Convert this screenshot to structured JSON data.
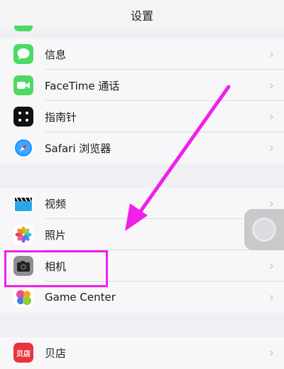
{
  "header": {
    "title": "设置"
  },
  "groups": [
    {
      "items": [
        {
          "label": "信息",
          "icon": "messages-icon"
        },
        {
          "label": "FaceTime 通话",
          "icon": "facetime-icon"
        },
        {
          "label": "指南针",
          "icon": "compass-icon"
        },
        {
          "label": "Safari 浏览器",
          "icon": "safari-icon"
        }
      ]
    },
    {
      "items": [
        {
          "label": "视频",
          "icon": "videos-icon"
        },
        {
          "label": "照片",
          "icon": "photos-icon"
        },
        {
          "label": "相机",
          "icon": "camera-icon"
        },
        {
          "label": "Game Center",
          "icon": "game-center-icon"
        }
      ]
    },
    {
      "items": [
        {
          "label": "贝店",
          "icon": "beidian-app-icon",
          "icon_text": "贝店"
        }
      ]
    }
  ],
  "colors": {
    "background": "#efeff4",
    "annotation": "#f020e8",
    "messages": "#4cd964",
    "facetime": "#4cd964",
    "beidian": "#e8343e"
  }
}
